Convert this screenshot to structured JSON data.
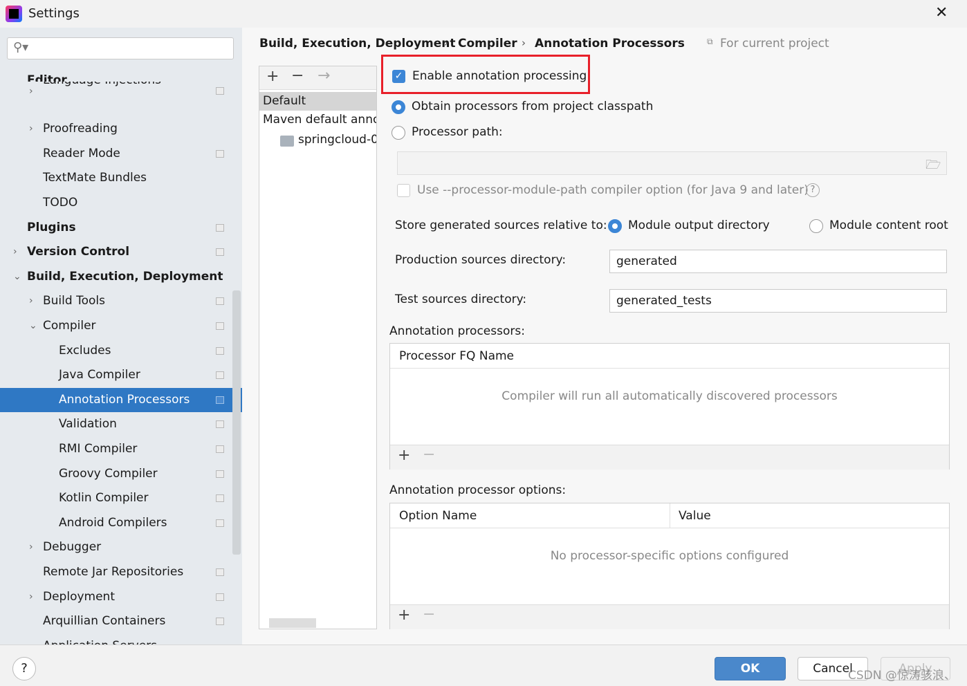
{
  "window": {
    "title": "Settings",
    "close": "✕"
  },
  "search": {
    "placeholder": "",
    "icon": "search-icon"
  },
  "tree": [
    {
      "label": "Editor",
      "bold": true,
      "indent": 0,
      "arrow": ""
    },
    {
      "label": "Language Injections",
      "indent": 1,
      "arrow": "›",
      "copy": true
    },
    {
      "label": "Proofreading",
      "indent": 1,
      "arrow": "›"
    },
    {
      "label": "Reader Mode",
      "indent": 1,
      "arrow": "",
      "copy": true
    },
    {
      "label": "TextMate Bundles",
      "indent": 1,
      "arrow": ""
    },
    {
      "label": "TODO",
      "indent": 1,
      "arrow": ""
    },
    {
      "label": "Plugins",
      "bold": true,
      "indent": 0,
      "arrow": "",
      "copy": true
    },
    {
      "label": "Version Control",
      "bold": true,
      "indent": 0,
      "arrow": "›",
      "copy": true
    },
    {
      "label": "Build, Execution, Deployment",
      "bold": true,
      "indent": 0,
      "arrow": "⌄"
    },
    {
      "label": "Build Tools",
      "indent": 1,
      "arrow": "›",
      "copy": true
    },
    {
      "label": "Compiler",
      "indent": 1,
      "arrow": "⌄",
      "copy": true
    },
    {
      "label": "Excludes",
      "indent": 2,
      "arrow": "",
      "copy": true
    },
    {
      "label": "Java Compiler",
      "indent": 2,
      "arrow": "",
      "copy": true
    },
    {
      "label": "Annotation Processors",
      "indent": 2,
      "arrow": "",
      "copy": true,
      "selected": true
    },
    {
      "label": "Validation",
      "indent": 2,
      "arrow": "",
      "copy": true
    },
    {
      "label": "RMI Compiler",
      "indent": 2,
      "arrow": "",
      "copy": true
    },
    {
      "label": "Groovy Compiler",
      "indent": 2,
      "arrow": "",
      "copy": true
    },
    {
      "label": "Kotlin Compiler",
      "indent": 2,
      "arrow": "",
      "copy": true
    },
    {
      "label": "Android Compilers",
      "indent": 2,
      "arrow": "",
      "copy": true
    },
    {
      "label": "Debugger",
      "indent": 1,
      "arrow": "›"
    },
    {
      "label": "Remote Jar Repositories",
      "indent": 1,
      "arrow": "",
      "copy": true
    },
    {
      "label": "Deployment",
      "indent": 1,
      "arrow": "›",
      "copy": true
    },
    {
      "label": "Arquillian Containers",
      "indent": 1,
      "arrow": "",
      "copy": true
    },
    {
      "label": "Application Servers",
      "indent": 1,
      "arrow": ""
    }
  ],
  "breadcrumb": [
    "Build, Execution, Deployment",
    "Compiler",
    "Annotation Processors"
  ],
  "scope": "For current project",
  "profiles": {
    "items": [
      "Default",
      "Maven default anno",
      "springcloud-0"
    ]
  },
  "options": {
    "enable": "Enable annotation processing",
    "obtain": "Obtain processors from project classpath",
    "path": "Processor path:",
    "path_value": "",
    "module_path": "Use --processor-module-path compiler option (for Java 9 and later)",
    "store_label": "Store generated sources relative to:",
    "store_output": "Module output directory",
    "store_content": "Module content root",
    "prod_label": "Production sources directory:",
    "prod_value": "generated",
    "test_label": "Test sources directory:",
    "test_value": "generated_tests"
  },
  "processors": {
    "title": "Annotation processors:",
    "column": "Processor FQ Name",
    "empty": "Compiler will run all automatically discovered processors"
  },
  "proc_options": {
    "title": "Annotation processor options:",
    "columns": [
      "Option Name",
      "Value"
    ],
    "empty": "No processor-specific options configured"
  },
  "footer": {
    "help": "?",
    "ok": "OK",
    "cancel": "Cancel",
    "apply": "Apply",
    "watermark": "CSDN @惊涛骇浪、"
  },
  "colors": {
    "accent": "#2f78c4",
    "highlight_box": "#e8202a"
  }
}
